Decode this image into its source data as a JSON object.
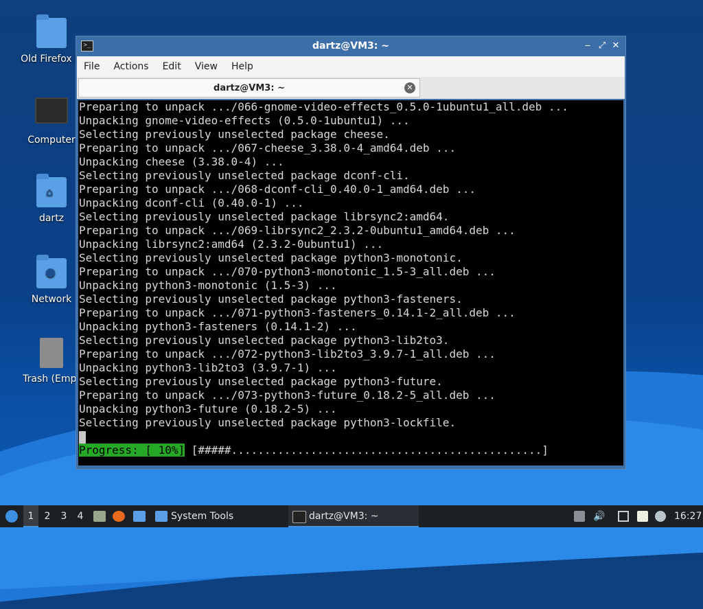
{
  "desktop": {
    "icons": [
      {
        "label": "Old Firefox D",
        "icon": "folder-icon"
      },
      {
        "label": "Computer",
        "icon": "computer-icon"
      },
      {
        "label": "dartz",
        "icon": "home-folder-icon"
      },
      {
        "label": "Network",
        "icon": "network-folder-icon"
      },
      {
        "label": "Trash (Empt",
        "icon": "trash-icon"
      }
    ]
  },
  "window": {
    "title": "dartz@VM3: ~",
    "controls": {
      "minimize": "‒",
      "maximize": "⤢",
      "close": "✕"
    },
    "menu": [
      "File",
      "Actions",
      "Edit",
      "View",
      "Help"
    ],
    "tab": {
      "label": "dartz@VM3: ~",
      "close": "✕"
    },
    "terminal": {
      "lines": [
        "Preparing to unpack .../066-gnome-video-effects_0.5.0-1ubuntu1_all.deb ...",
        "Unpacking gnome-video-effects (0.5.0-1ubuntu1) ...",
        "Selecting previously unselected package cheese.",
        "Preparing to unpack .../067-cheese_3.38.0-4_amd64.deb ...",
        "Unpacking cheese (3.38.0-4) ...",
        "Selecting previously unselected package dconf-cli.",
        "Preparing to unpack .../068-dconf-cli_0.40.0-1_amd64.deb ...",
        "Unpacking dconf-cli (0.40.0-1) ...",
        "Selecting previously unselected package librsync2:amd64.",
        "Preparing to unpack .../069-librsync2_2.3.2-0ubuntu1_amd64.deb ...",
        "Unpacking librsync2:amd64 (2.3.2-0ubuntu1) ...",
        "Selecting previously unselected package python3-monotonic.",
        "Preparing to unpack .../070-python3-monotonic_1.5-3_all.deb ...",
        "Unpacking python3-monotonic (1.5-3) ...",
        "Selecting previously unselected package python3-fasteners.",
        "Preparing to unpack .../071-python3-fasteners_0.14.1-2_all.deb ...",
        "Unpacking python3-fasteners (0.14.1-2) ...",
        "Selecting previously unselected package python3-lib2to3.",
        "Preparing to unpack .../072-python3-lib2to3_3.9.7-1_all.deb ...",
        "Unpacking python3-lib2to3 (3.9.7-1) ...",
        "Selecting previously unselected package python3-future.",
        "Preparing to unpack .../073-python3-future_0.18.2-5_all.deb ...",
        "Unpacking python3-future (0.18.2-5) ...",
        "Selecting previously unselected package python3-lockfile."
      ],
      "progress_label": "Progress: [ 10%]",
      "progress_bar": " [#####...............................................]",
      "progress_percent": 10
    }
  },
  "taskbar": {
    "workspaces": [
      "1",
      "2",
      "3",
      "4"
    ],
    "active_workspace": "1",
    "tasks": [
      {
        "label": "System Tools",
        "icon": "folder-icon"
      },
      {
        "label": "dartz@VM3: ~",
        "icon": "terminal-icon"
      }
    ],
    "clock": "16:27"
  },
  "colors": {
    "desktop_bg": "#0a4189",
    "window_frame": "#3c6ea8",
    "terminal_bg": "#000000",
    "terminal_fg": "#d8d8d8",
    "progress_green": "#26a826",
    "taskbar_bg": "#1c1f24"
  }
}
